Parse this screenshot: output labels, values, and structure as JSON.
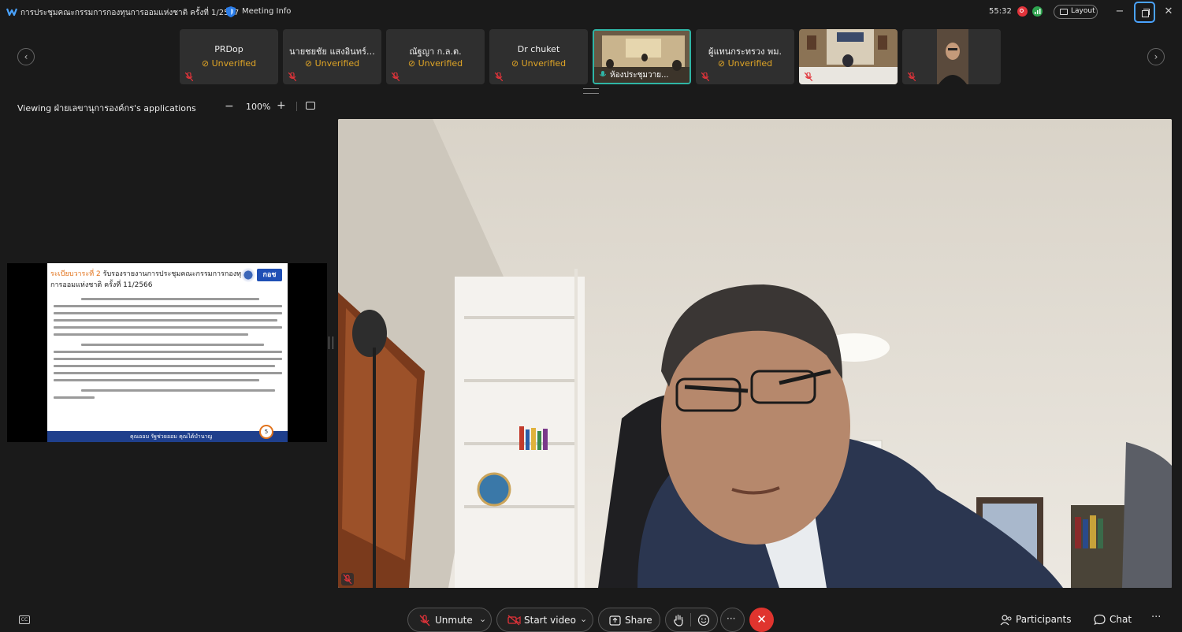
{
  "window": {
    "title": "การประชุมคณะกรรมการกองทุนการออมแห่งชาติ ครั้งที่ 1/2567",
    "meeting_info": "Meeting Info",
    "timer": "55:32",
    "layout_label": "Layout"
  },
  "participants": [
    {
      "name": "PRDop",
      "status": "Unverified"
    },
    {
      "name": "นายชยชัย แสงอินทร์ (...",
      "status": "Unverified"
    },
    {
      "name": "ณัฐญา  ก.ล.ต.",
      "status": "Unverified"
    },
    {
      "name": "Dr chuket",
      "status": "Unverified"
    },
    {
      "name": "ห้องประชุมวาย...",
      "status": ""
    },
    {
      "name": "ผู้แทนกระทรวง พม.",
      "status": "Unverified"
    },
    {
      "name": "",
      "status": ""
    },
    {
      "name": "",
      "status": ""
    }
  ],
  "viewing": {
    "text": "Viewing ฝ่ายเลขานุการองค์กร's applications",
    "zoom_minus": "−",
    "zoom": "100%",
    "zoom_plus": "+"
  },
  "slide": {
    "heading_prefix": "ระเบียบวาระที่ 2",
    "heading_rest": "รับรองรายงานการประชุมคณะกรรมการกองทุน",
    "heading_line2": "การออมแห่งชาติ ครั้งที่ 11/2566",
    "logo_text": "กอช",
    "footer": "คุณออม รัฐช่วยออม คุณได้บำนาญ",
    "page": "5"
  },
  "controls": {
    "cc": "CC",
    "unmute": "Unmute",
    "start_video": "Start video",
    "share": "Share",
    "leave": "✕",
    "participants": "Participants",
    "chat": "Chat",
    "more": "···"
  },
  "colors": {
    "background": "#1a1a1a",
    "tile": "#2f2f2f",
    "unverified": "#e0a526",
    "active_border": "#2fb5a5",
    "leave": "#e0342e",
    "accent": "#4aa3ff"
  }
}
